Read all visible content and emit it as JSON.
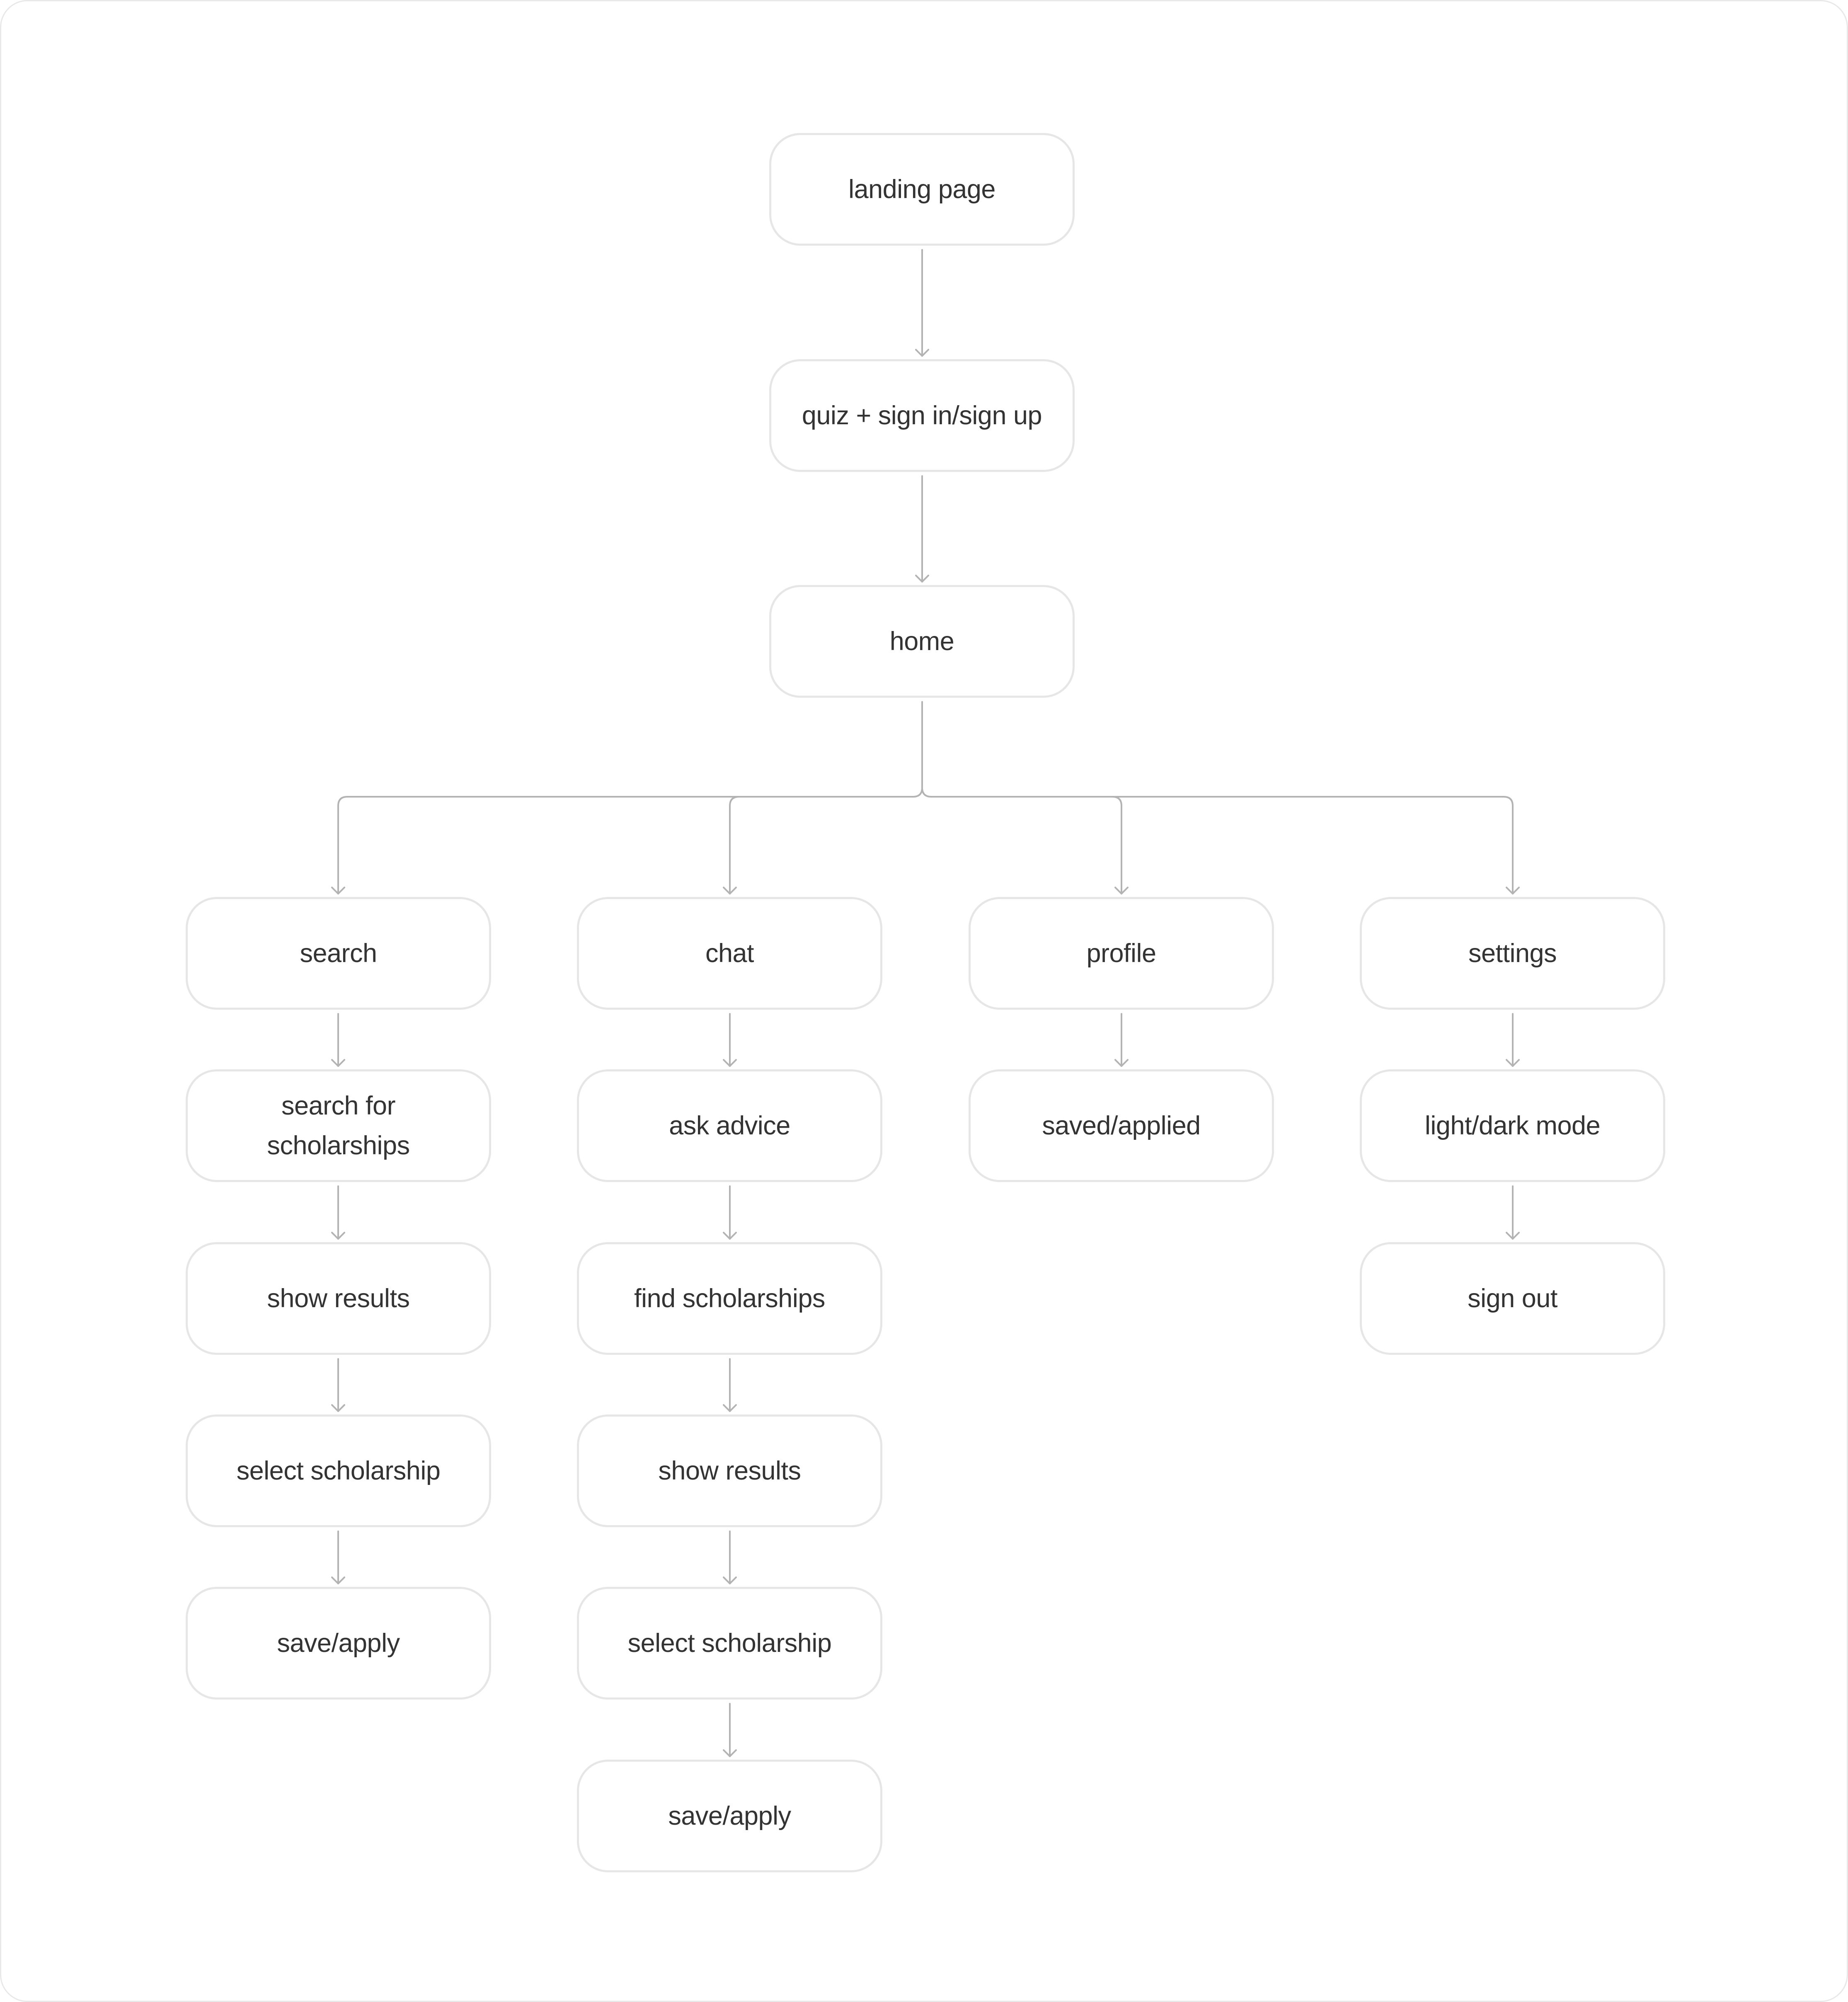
{
  "diagram": {
    "type": "flowchart",
    "colors": {
      "node_border": "#e6e6e6",
      "node_text": "#333333",
      "connector": "#b3b3b3",
      "background": "#ffffff"
    },
    "main_flow": [
      {
        "id": "landing",
        "label": "landing page"
      },
      {
        "id": "quiz",
        "label": "quiz + sign in/sign up"
      },
      {
        "id": "home",
        "label": "home"
      }
    ],
    "branches": [
      {
        "id": "search",
        "nodes": [
          {
            "label": "search"
          },
          {
            "label": "search for scholarships"
          },
          {
            "label": "show results"
          },
          {
            "label": "select scholarship"
          },
          {
            "label": "save/apply"
          }
        ]
      },
      {
        "id": "chat",
        "nodes": [
          {
            "label": "chat"
          },
          {
            "label": "ask advice"
          },
          {
            "label": "find scholarships"
          },
          {
            "label": "show results"
          },
          {
            "label": "select scholarship"
          },
          {
            "label": "save/apply"
          }
        ]
      },
      {
        "id": "profile",
        "nodes": [
          {
            "label": "profile"
          },
          {
            "label": "saved/applied"
          }
        ]
      },
      {
        "id": "settings",
        "nodes": [
          {
            "label": "settings"
          },
          {
            "label": "light/dark mode"
          },
          {
            "label": "sign out"
          }
        ]
      }
    ],
    "edges": [
      [
        "landing page",
        "quiz + sign in/sign up"
      ],
      [
        "quiz + sign in/sign up",
        "home"
      ],
      [
        "home",
        "search"
      ],
      [
        "home",
        "chat"
      ],
      [
        "home",
        "profile"
      ],
      [
        "home",
        "settings"
      ],
      [
        "search",
        "search for scholarships"
      ],
      [
        "search for scholarships",
        "show results"
      ],
      [
        "show results",
        "select scholarship"
      ],
      [
        "select scholarship",
        "save/apply"
      ],
      [
        "chat",
        "ask advice"
      ],
      [
        "ask advice",
        "find scholarships"
      ],
      [
        "find scholarships",
        "show results"
      ],
      [
        "show results",
        "select scholarship"
      ],
      [
        "select scholarship",
        "save/apply"
      ],
      [
        "profile",
        "saved/applied"
      ],
      [
        "settings",
        "light/dark mode"
      ],
      [
        "light/dark mode",
        "sign out"
      ]
    ]
  }
}
